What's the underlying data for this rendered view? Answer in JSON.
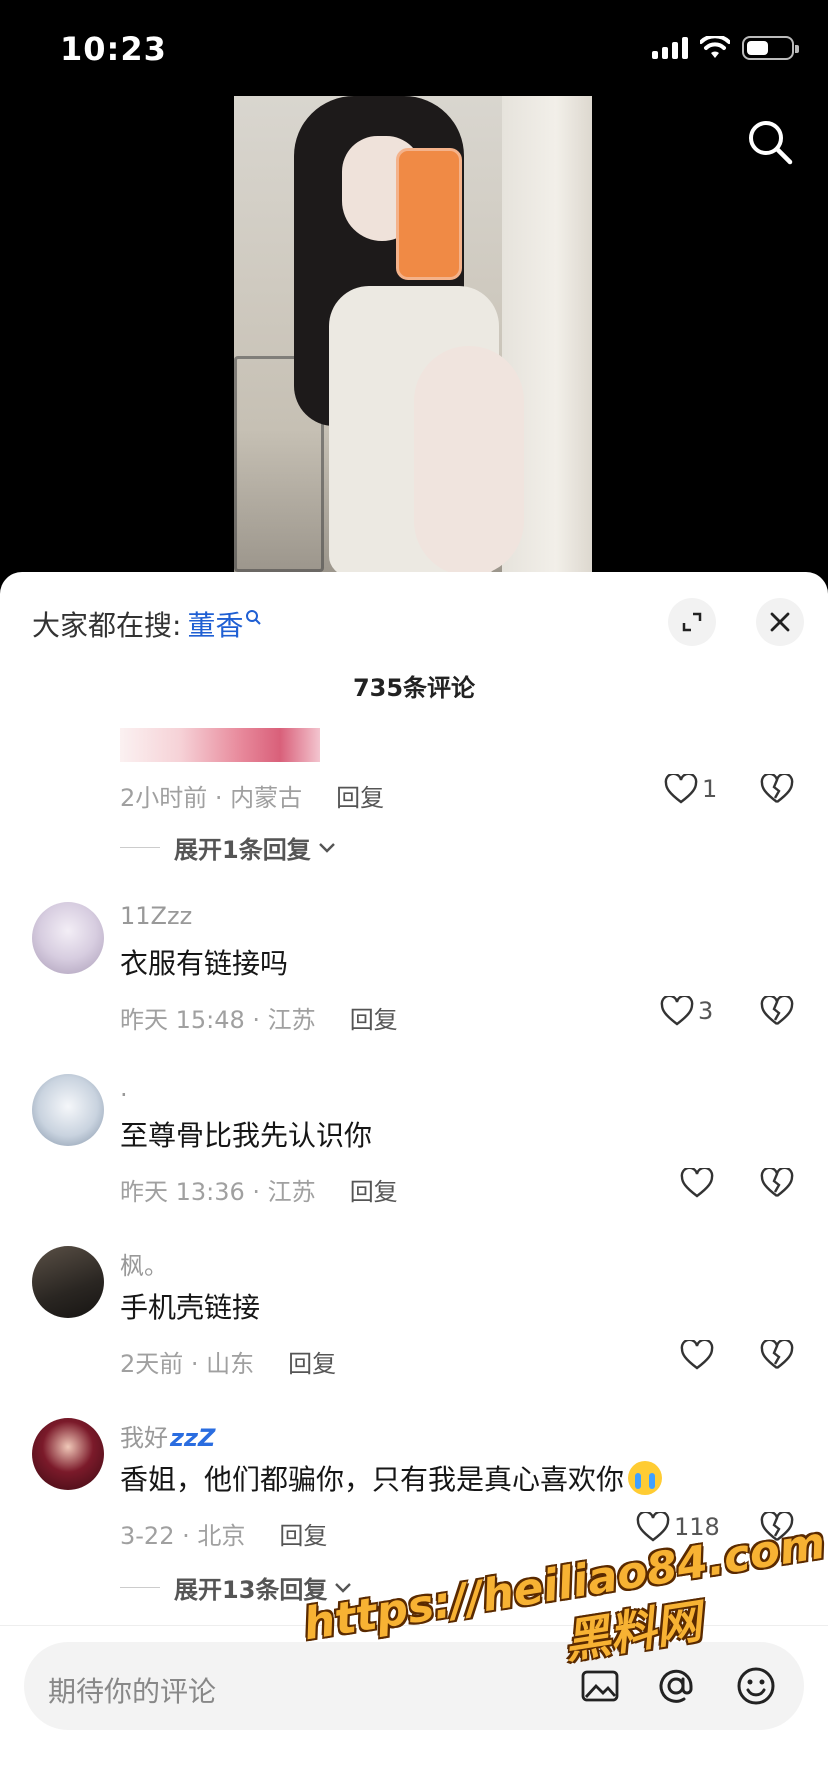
{
  "status_bar": {
    "time": "10:23"
  },
  "sheet": {
    "hot_search_prefix": "大家都在搜:",
    "hot_search_keyword": "董香",
    "comment_count": "735条评论"
  },
  "comments": [
    {
      "meta": "2小时前 · 内蒙古",
      "reply": "回复",
      "likes": "1",
      "expand": "展开1条回复"
    },
    {
      "username": "11Zzz",
      "text": "衣服有链接吗",
      "meta": "昨天 15:48 · 江苏",
      "reply": "回复",
      "likes": "3"
    },
    {
      "username": ".",
      "text": "至尊骨比我先认识你",
      "meta": "昨天 13:36 · 江苏",
      "reply": "回复",
      "likes": ""
    },
    {
      "username": "枫。",
      "text": "手机壳链接",
      "meta": "2天前 · 山东",
      "reply": "回复",
      "likes": ""
    },
    {
      "username": "我好",
      "username_badge": "zzZ",
      "text": "香姐，他们都骗你，只有我是真心喜欢你",
      "meta": "3-22 · 北京",
      "reply": "回复",
      "likes": "118",
      "expand": "展开13条回复"
    }
  ],
  "input": {
    "placeholder": "期待你的评论"
  },
  "watermark": {
    "url": "https://heiliao84.com",
    "name": "黑料网"
  },
  "icons": {
    "search": "search-icon",
    "expand": "expand-icon",
    "close": "close-icon",
    "heart": "heart-icon",
    "dislike": "broken-heart-icon",
    "chevron": "chevron-down-icon",
    "image": "image-icon",
    "at": "at-icon",
    "emoji": "emoji-icon"
  },
  "colors": {
    "accent": "#1f5fd3",
    "watermark": "#f7b233"
  }
}
